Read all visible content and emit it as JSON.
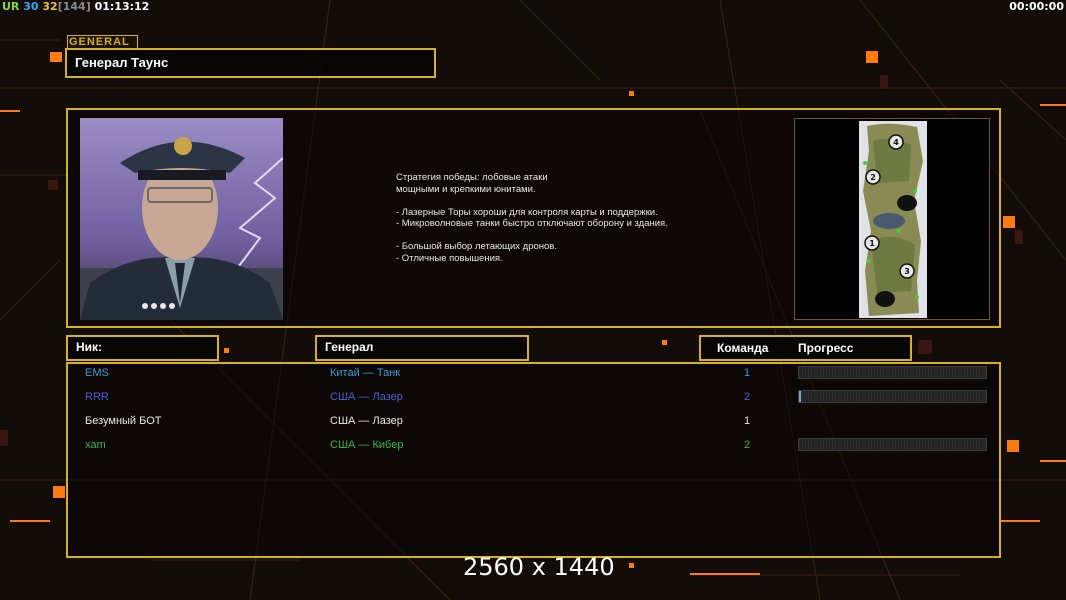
{
  "hud": {
    "ur_label": "UR",
    "value_a": "30",
    "value_b": "32",
    "value_c": "[144]",
    "clock_left": "01:13:12",
    "clock_right": "00:00:00"
  },
  "general_tag": "GENERAL",
  "general_name": "Генерал Таунс",
  "description": "Стратегия победы: лобовые атаки\nмощными и крепкими юнитами.\n\n- Лазерные Торы хороши для контроля карты и поддержки.\n- Микроволновые танки быстро отключают оборону и здания.\n\n- Большой выбор летающих дронов.\n- Отличные повышения.",
  "map_markers": [
    "4",
    "2",
    "1",
    "3"
  ],
  "table": {
    "col_nick": "Ник:",
    "col_general": "Генерал",
    "col_team": "Команда",
    "col_progress": "Прогресс",
    "rows": [
      {
        "nick": "EMS",
        "general": "Китай — Танк",
        "team": "1",
        "color": "#3a9bd8",
        "progress": 0,
        "show_bar": true
      },
      {
        "nick": "RRR",
        "general": "США — Лазер",
        "team": "2",
        "color": "#4a62d8",
        "progress": 0.01,
        "show_bar": true
      },
      {
        "nick": "Безумный БОТ",
        "general": "США — Лазер",
        "team": "1",
        "color": "#e8e8e8",
        "progress": 0,
        "show_bar": false
      },
      {
        "nick": "xam",
        "general": "США — Кибер",
        "team": "2",
        "color": "#3db83d",
        "progress": 0,
        "show_bar": true
      }
    ]
  },
  "resolution": "2560 x 1440",
  "colors": {
    "accent": "#d8b21a",
    "background": "#130d0a",
    "orange": "#ff7a10"
  }
}
